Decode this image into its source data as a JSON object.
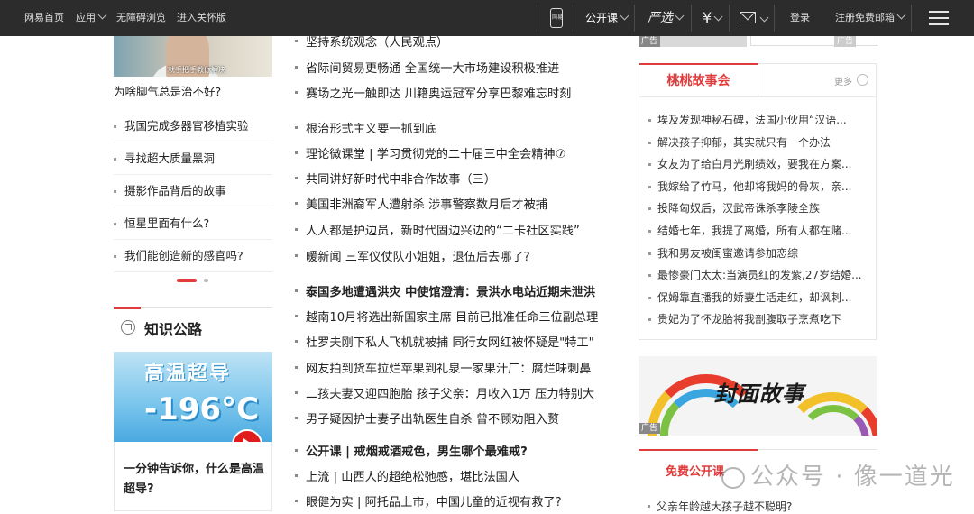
{
  "topbar": {
    "home": "网易首页",
    "apps": "应用",
    "accessible": "无障碍浏览",
    "elder": "进入关怀版",
    "mobile_label": "网易",
    "open_course": "公开课",
    "yanxuan": "严选",
    "pay_symbol": "¥",
    "login": "登录",
    "register": "注册免费邮箱"
  },
  "left": {
    "thumb_caption_overlay": "就手把手教你解决",
    "thumb_title": "为啥脚气总是治不好?",
    "items": [
      "我国完成多器官移植实验",
      "寻找超大质量黑洞",
      "摄影作品背后的故事",
      "恒星里面有什么?",
      "我们能创造新的感官吗?"
    ],
    "section_title": "知识公路",
    "promo_img_line1": "高温超导",
    "promo_img_line2": "-196°C",
    "promo_caption": "一分钟告诉你，什么是高温超导?"
  },
  "middle": {
    "groups": [
      {
        "bold": false,
        "rows": [
          "坚持系统观念（人民观点）",
          "省际间贸易更畅通 全国统一大市场建设积极推进",
          "赛场之光一触即达 川籍奥运冠军分享巴黎难忘时刻"
        ]
      },
      {
        "bold": false,
        "rows": [
          "根治形式主义要一抓到底",
          "理论微课堂 | 学习贯彻党的二十届三中全会精神⑦",
          "共同讲好新时代中非合作故事（三）",
          "美国非洲裔军人遭射杀 涉事警察数月后才被捕",
          "人人都是护边员，新时代固边兴边的“二卡社区实践”",
          "暖新闻 三军仪仗队小姐姐，退伍后去哪了?"
        ]
      },
      {
        "bold_first": true,
        "rows": [
          "泰国多地遭遇洪灾 中使馆澄清：景洪水电站近期未泄洪",
          "越南10月将选出新国家主席 目前已批准任命三位副总理",
          "杜罗夫刚下私人飞机就被捕 同行女网红被怀疑是\"特工\"",
          "网友拍到货车拉烂苹果到礼泉一家果汁厂：腐烂味刺鼻",
          "二孩夫妻又迎四胞胎 孩子父亲：月收入1万 压力特别大",
          "男子疑因护士妻子出轨医生自杀 曾不顾劝阻入赘"
        ]
      },
      {
        "bold_first": true,
        "rows": [
          "公开课 | 戒烟戒酒戒色，男生哪个最难戒?",
          "上流 | 山西人的超绝松弛感，堪比法国人",
          "眼健为实 | 阿托品上市，中国儿童的近视有救了?"
        ]
      }
    ]
  },
  "right": {
    "ad_label": "广告",
    "ad_side_label": "广告",
    "story_tab": "桃桃故事会",
    "more": "更多",
    "stories": [
      "埃及发现神秘石碑，法国小伙用“汉语...",
      "解决孩子抑郁，其实就只有一个办法",
      "女友为了给白月光刷绩效，要我在方案...",
      "我嫁给了竹马，他却将我妈的骨灰，亲...",
      "投降匈奴后，汉武帝诛杀李陵全族",
      "结婚七年，我提了离婚，所有人都在赌...",
      "我和男友被闺蜜邀请参加恋综",
      "最惨豪门太太:当演员红的发紫,27岁结婚...",
      "保姆靠直播我的娇妻生活走红，却讽刺...",
      "贵妃为了怀龙胎将我剖腹取子烹煮吃下"
    ],
    "cover_text": "封面故事",
    "cover_ad": "广告",
    "free_course": "免费公开课",
    "free_first": "父亲年龄越大孩子越不聪明?"
  },
  "watermark": "公众号 · 像一道光"
}
